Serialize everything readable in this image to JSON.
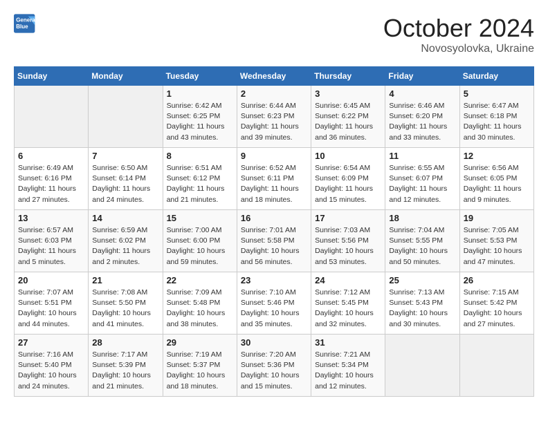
{
  "header": {
    "logo_line1": "General",
    "logo_line2": "Blue",
    "month": "October 2024",
    "location": "Novosyolovka, Ukraine"
  },
  "days_of_week": [
    "Sunday",
    "Monday",
    "Tuesday",
    "Wednesday",
    "Thursday",
    "Friday",
    "Saturday"
  ],
  "weeks": [
    [
      {
        "day": "",
        "info": ""
      },
      {
        "day": "",
        "info": ""
      },
      {
        "day": "1",
        "info": "Sunrise: 6:42 AM\nSunset: 6:25 PM\nDaylight: 11 hours and 43 minutes."
      },
      {
        "day": "2",
        "info": "Sunrise: 6:44 AM\nSunset: 6:23 PM\nDaylight: 11 hours and 39 minutes."
      },
      {
        "day": "3",
        "info": "Sunrise: 6:45 AM\nSunset: 6:22 PM\nDaylight: 11 hours and 36 minutes."
      },
      {
        "day": "4",
        "info": "Sunrise: 6:46 AM\nSunset: 6:20 PM\nDaylight: 11 hours and 33 minutes."
      },
      {
        "day": "5",
        "info": "Sunrise: 6:47 AM\nSunset: 6:18 PM\nDaylight: 11 hours and 30 minutes."
      }
    ],
    [
      {
        "day": "6",
        "info": "Sunrise: 6:49 AM\nSunset: 6:16 PM\nDaylight: 11 hours and 27 minutes."
      },
      {
        "day": "7",
        "info": "Sunrise: 6:50 AM\nSunset: 6:14 PM\nDaylight: 11 hours and 24 minutes."
      },
      {
        "day": "8",
        "info": "Sunrise: 6:51 AM\nSunset: 6:12 PM\nDaylight: 11 hours and 21 minutes."
      },
      {
        "day": "9",
        "info": "Sunrise: 6:52 AM\nSunset: 6:11 PM\nDaylight: 11 hours and 18 minutes."
      },
      {
        "day": "10",
        "info": "Sunrise: 6:54 AM\nSunset: 6:09 PM\nDaylight: 11 hours and 15 minutes."
      },
      {
        "day": "11",
        "info": "Sunrise: 6:55 AM\nSunset: 6:07 PM\nDaylight: 11 hours and 12 minutes."
      },
      {
        "day": "12",
        "info": "Sunrise: 6:56 AM\nSunset: 6:05 PM\nDaylight: 11 hours and 9 minutes."
      }
    ],
    [
      {
        "day": "13",
        "info": "Sunrise: 6:57 AM\nSunset: 6:03 PM\nDaylight: 11 hours and 5 minutes."
      },
      {
        "day": "14",
        "info": "Sunrise: 6:59 AM\nSunset: 6:02 PM\nDaylight: 11 hours and 2 minutes."
      },
      {
        "day": "15",
        "info": "Sunrise: 7:00 AM\nSunset: 6:00 PM\nDaylight: 10 hours and 59 minutes."
      },
      {
        "day": "16",
        "info": "Sunrise: 7:01 AM\nSunset: 5:58 PM\nDaylight: 10 hours and 56 minutes."
      },
      {
        "day": "17",
        "info": "Sunrise: 7:03 AM\nSunset: 5:56 PM\nDaylight: 10 hours and 53 minutes."
      },
      {
        "day": "18",
        "info": "Sunrise: 7:04 AM\nSunset: 5:55 PM\nDaylight: 10 hours and 50 minutes."
      },
      {
        "day": "19",
        "info": "Sunrise: 7:05 AM\nSunset: 5:53 PM\nDaylight: 10 hours and 47 minutes."
      }
    ],
    [
      {
        "day": "20",
        "info": "Sunrise: 7:07 AM\nSunset: 5:51 PM\nDaylight: 10 hours and 44 minutes."
      },
      {
        "day": "21",
        "info": "Sunrise: 7:08 AM\nSunset: 5:50 PM\nDaylight: 10 hours and 41 minutes."
      },
      {
        "day": "22",
        "info": "Sunrise: 7:09 AM\nSunset: 5:48 PM\nDaylight: 10 hours and 38 minutes."
      },
      {
        "day": "23",
        "info": "Sunrise: 7:10 AM\nSunset: 5:46 PM\nDaylight: 10 hours and 35 minutes."
      },
      {
        "day": "24",
        "info": "Sunrise: 7:12 AM\nSunset: 5:45 PM\nDaylight: 10 hours and 32 minutes."
      },
      {
        "day": "25",
        "info": "Sunrise: 7:13 AM\nSunset: 5:43 PM\nDaylight: 10 hours and 30 minutes."
      },
      {
        "day": "26",
        "info": "Sunrise: 7:15 AM\nSunset: 5:42 PM\nDaylight: 10 hours and 27 minutes."
      }
    ],
    [
      {
        "day": "27",
        "info": "Sunrise: 7:16 AM\nSunset: 5:40 PM\nDaylight: 10 hours and 24 minutes."
      },
      {
        "day": "28",
        "info": "Sunrise: 7:17 AM\nSunset: 5:39 PM\nDaylight: 10 hours and 21 minutes."
      },
      {
        "day": "29",
        "info": "Sunrise: 7:19 AM\nSunset: 5:37 PM\nDaylight: 10 hours and 18 minutes."
      },
      {
        "day": "30",
        "info": "Sunrise: 7:20 AM\nSunset: 5:36 PM\nDaylight: 10 hours and 15 minutes."
      },
      {
        "day": "31",
        "info": "Sunrise: 7:21 AM\nSunset: 5:34 PM\nDaylight: 10 hours and 12 minutes."
      },
      {
        "day": "",
        "info": ""
      },
      {
        "day": "",
        "info": ""
      }
    ]
  ]
}
